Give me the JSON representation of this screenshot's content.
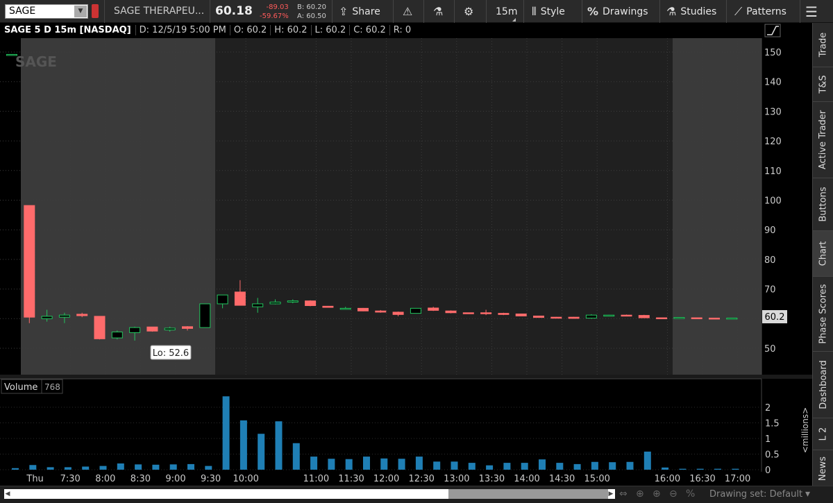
{
  "toolbar": {
    "symbol": "SAGE",
    "company": "SAGE THERAPEU...",
    "last_price": "60.18",
    "net_change": "-89.03",
    "pct_change": "-59.67%",
    "bid": "B: 60.20",
    "ask": "A: 60.50",
    "share_label": "Share",
    "timeframe": "15m",
    "style_label": "Style",
    "drawings_label": "Drawings",
    "studies_label": "Studies",
    "patterns_label": "Patterns"
  },
  "chart_header": {
    "title": "SAGE 5 D 15m [NASDAQ]",
    "date": "D: 12/5/19 5:00 PM",
    "open": "O: 60.2",
    "high": "H: 60.2",
    "low": "L: 60.2",
    "close": "C: 60.2",
    "range": "R: 0"
  },
  "price_axis": {
    "ticks": [
      "150",
      "140",
      "130",
      "120",
      "110",
      "100",
      "90",
      "80",
      "70",
      "60",
      "50"
    ],
    "current_label": "60.2"
  },
  "volume_pane": {
    "title": "Volume",
    "value": "768",
    "unit_label": "<millions>",
    "ticks": [
      "2",
      "1.5",
      "1",
      "0.5",
      "0"
    ]
  },
  "time_axis": {
    "labels": [
      "Thu",
      "7:30",
      "8:00",
      "8:30",
      "9:00",
      "9:30",
      "10:00",
      "11:00",
      "11:30",
      "12:00",
      "12:30",
      "13:00",
      "13:30",
      "14:00",
      "14:30",
      "15:00",
      "16:00",
      "16:30",
      "17:00"
    ]
  },
  "low_bubble": "Lo: 52.6",
  "watermark": "SAGE",
  "side_tabs": [
    "Trade",
    "T&S",
    "Active Trader",
    "Buttons",
    "Chart",
    "Phase Scores",
    "Dashboard",
    "L 2",
    "News"
  ],
  "status": {
    "drawing_set": "Drawing set: Default"
  },
  "colors": {
    "up": "#22c55e",
    "down": "#ff6b6b",
    "volume": "#1f7fb5",
    "extended_hours_bg": "#3a3a3a",
    "regular_hours_bg": "#202020"
  },
  "chart_data": {
    "type": "candlestick",
    "price_ylim": [
      40,
      155
    ],
    "volume_ylim_millions": [
      0,
      2.4
    ],
    "candles": [
      {
        "o": 149.2,
        "h": 149.2,
        "l": 149.2,
        "c": 149.2
      },
      {
        "o": 98.2,
        "h": 98.2,
        "l": 58.5,
        "c": 60.5
      },
      {
        "o": 60.0,
        "h": 63.0,
        "l": 59.0,
        "c": 60.8
      },
      {
        "o": 60.5,
        "h": 62.0,
        "l": 58.5,
        "c": 61.2
      },
      {
        "o": 61.5,
        "h": 62.0,
        "l": 60.5,
        "c": 61.0
      },
      {
        "o": 60.8,
        "h": 60.8,
        "l": 53.0,
        "c": 53.2
      },
      {
        "o": 53.5,
        "h": 56.0,
        "l": 53.0,
        "c": 55.5
      },
      {
        "o": 55.3,
        "h": 57.3,
        "l": 52.6,
        "c": 57.0
      },
      {
        "o": 57.2,
        "h": 57.2,
        "l": 55.6,
        "c": 55.8
      },
      {
        "o": 56.2,
        "h": 57.3,
        "l": 55.6,
        "c": 56.8
      },
      {
        "o": 57.3,
        "h": 57.5,
        "l": 56.0,
        "c": 56.7
      },
      {
        "o": 57.0,
        "h": 65.0,
        "l": 57.0,
        "c": 65.0
      },
      {
        "o": 65.0,
        "h": 68.0,
        "l": 63.5,
        "c": 68.0
      },
      {
        "o": 69.0,
        "h": 73.0,
        "l": 64.5,
        "c": 64.5
      },
      {
        "o": 64.0,
        "h": 67.0,
        "l": 62.0,
        "c": 65.0
      },
      {
        "o": 65.0,
        "h": 66.5,
        "l": 64.8,
        "c": 65.6
      },
      {
        "o": 65.6,
        "h": 66.5,
        "l": 65.2,
        "c": 66.0
      },
      {
        "o": 66.0,
        "h": 66.2,
        "l": 64.2,
        "c": 64.4
      },
      {
        "o": 64.2,
        "h": 64.3,
        "l": 63.8,
        "c": 63.8
      },
      {
        "o": 63.5,
        "h": 64.0,
        "l": 63.2,
        "c": 63.5
      },
      {
        "o": 63.5,
        "h": 63.6,
        "l": 62.5,
        "c": 62.6
      },
      {
        "o": 62.6,
        "h": 62.9,
        "l": 62.0,
        "c": 62.2
      },
      {
        "o": 62.2,
        "h": 62.4,
        "l": 60.8,
        "c": 61.4
      },
      {
        "o": 61.8,
        "h": 63.5,
        "l": 61.8,
        "c": 63.5
      },
      {
        "o": 63.6,
        "h": 64.0,
        "l": 62.6,
        "c": 62.8
      },
      {
        "o": 62.6,
        "h": 62.8,
        "l": 61.8,
        "c": 62.0
      },
      {
        "o": 62.0,
        "h": 62.0,
        "l": 61.9,
        "c": 61.9
      },
      {
        "o": 62.0,
        "h": 63.0,
        "l": 61.2,
        "c": 61.8
      },
      {
        "o": 61.8,
        "h": 62.0,
        "l": 61.2,
        "c": 61.4
      },
      {
        "o": 61.6,
        "h": 61.6,
        "l": 60.9,
        "c": 60.9
      },
      {
        "o": 60.9,
        "h": 61.0,
        "l": 60.4,
        "c": 60.4
      },
      {
        "o": 60.5,
        "h": 60.6,
        "l": 60.2,
        "c": 60.2
      },
      {
        "o": 60.5,
        "h": 60.6,
        "l": 60.0,
        "c": 60.1
      },
      {
        "o": 60.2,
        "h": 61.5,
        "l": 60.0,
        "c": 61.2
      },
      {
        "o": 61.1,
        "h": 61.3,
        "l": 60.9,
        "c": 61.2
      },
      {
        "o": 61.2,
        "h": 61.4,
        "l": 60.9,
        "c": 61.0
      },
      {
        "o": 61.1,
        "h": 61.3,
        "l": 60.2,
        "c": 60.3
      },
      {
        "o": 60.3,
        "h": 60.3,
        "l": 60.2,
        "c": 60.2
      },
      {
        "o": 60.3,
        "h": 60.5,
        "l": 60.3,
        "c": 60.4
      },
      {
        "o": 60.3,
        "h": 60.3,
        "l": 60.2,
        "c": 60.2
      },
      {
        "o": 60.2,
        "h": 60.3,
        "l": 60.1,
        "c": 60.1
      },
      {
        "o": 60.2,
        "h": 60.2,
        "l": 60.2,
        "c": 60.2
      }
    ],
    "volume_millions": [
      0.05,
      0.15,
      0.08,
      0.08,
      0.1,
      0.12,
      0.2,
      0.17,
      0.16,
      0.17,
      0.18,
      0.12,
      2.35,
      1.58,
      1.15,
      1.55,
      0.85,
      0.42,
      0.35,
      0.34,
      0.42,
      0.36,
      0.35,
      0.42,
      0.26,
      0.26,
      0.22,
      0.14,
      0.22,
      0.22,
      0.33,
      0.22,
      0.18,
      0.25,
      0.24,
      0.25,
      0.58,
      0.07,
      0.03,
      0.03,
      0.03,
      0.03
    ]
  }
}
